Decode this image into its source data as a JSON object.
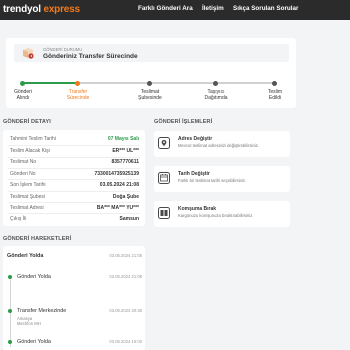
{
  "header": {
    "logo_primary": "trendyol",
    "logo_secondary": "express",
    "nav": [
      "Farklı Gönderi Ara",
      "İletişim",
      "Sıkça Sorulan Sorular"
    ]
  },
  "status": {
    "label": "GÖNDERİ DURUMU",
    "title": "Gönderiniz Transfer Sürecinde",
    "steps": [
      {
        "line1": "Gönderi",
        "line2": "Alındı",
        "state": "done"
      },
      {
        "line1": "Transfer",
        "line2": "Sürecinde",
        "state": "active"
      },
      {
        "line1": "Teslimat",
        "line2": "Şubesinde",
        "state": "pending"
      },
      {
        "line1": "Taşıyıcı",
        "line2": "Dağıtımda",
        "state": "pending"
      },
      {
        "line1": "Teslim",
        "line2": "Edildi",
        "state": "pending"
      }
    ]
  },
  "details": {
    "title": "GÖNDERİ DETAYI",
    "rows": [
      {
        "label": "Tahmini Teslim Tarihi",
        "value": "07 Mayıs Salı",
        "highlight": true
      },
      {
        "label": "Teslim Alacak Kişi",
        "value": "ER*** UL***"
      },
      {
        "label": "Teslimat No",
        "value": "8357770611"
      },
      {
        "label": "Gönderi No",
        "value": "7330014735925139"
      },
      {
        "label": "Son İşlem Tarihi",
        "value": "03.05.2024 21:08"
      },
      {
        "label": "Teslimat Şubesi",
        "value": "Doğa Şube"
      },
      {
        "label": "Teslimat Adresi",
        "value": "BA*** MA*** YU***"
      },
      {
        "label": "Çıkış İli",
        "value": "Samsun"
      }
    ]
  },
  "actions": {
    "title": "GÖNDERİ İŞLEMLERİ",
    "items": [
      {
        "title": "Adres Değiştir",
        "desc": "Mevcut teslimat adresinizi değiştirebilirsiniz."
      },
      {
        "title": "Tarih Değiştir",
        "desc": "Farklı bir teslimat tarihi seçebilirsiniz."
      },
      {
        "title": "Komşuma Bırak",
        "desc": "Kargonuzu komşunuza bıraktırabilirsiniz."
      }
    ]
  },
  "movements": {
    "title": "GÖNDERİ HAREKETLERİ",
    "items": [
      {
        "title": "Gönderi Yolda",
        "date": "03.05.2024 21:08",
        "sub": ""
      },
      {
        "title": "Gönderi Yolda",
        "date": "03.05.2024 21:08",
        "sub": ""
      },
      {
        "title": "Transfer Merkezinde",
        "date": "03.05.2024 20:48",
        "sub": "Amasya\nMerzifon MH"
      },
      {
        "title": "Gönderi Yolda",
        "date": "03.05.2024 15:03",
        "sub": ""
      }
    ]
  },
  "colors": {
    "accent": "#f27a1a",
    "done": "#2e9b4b",
    "pending": "#555555",
    "header_bg": "#2b2b2b"
  }
}
